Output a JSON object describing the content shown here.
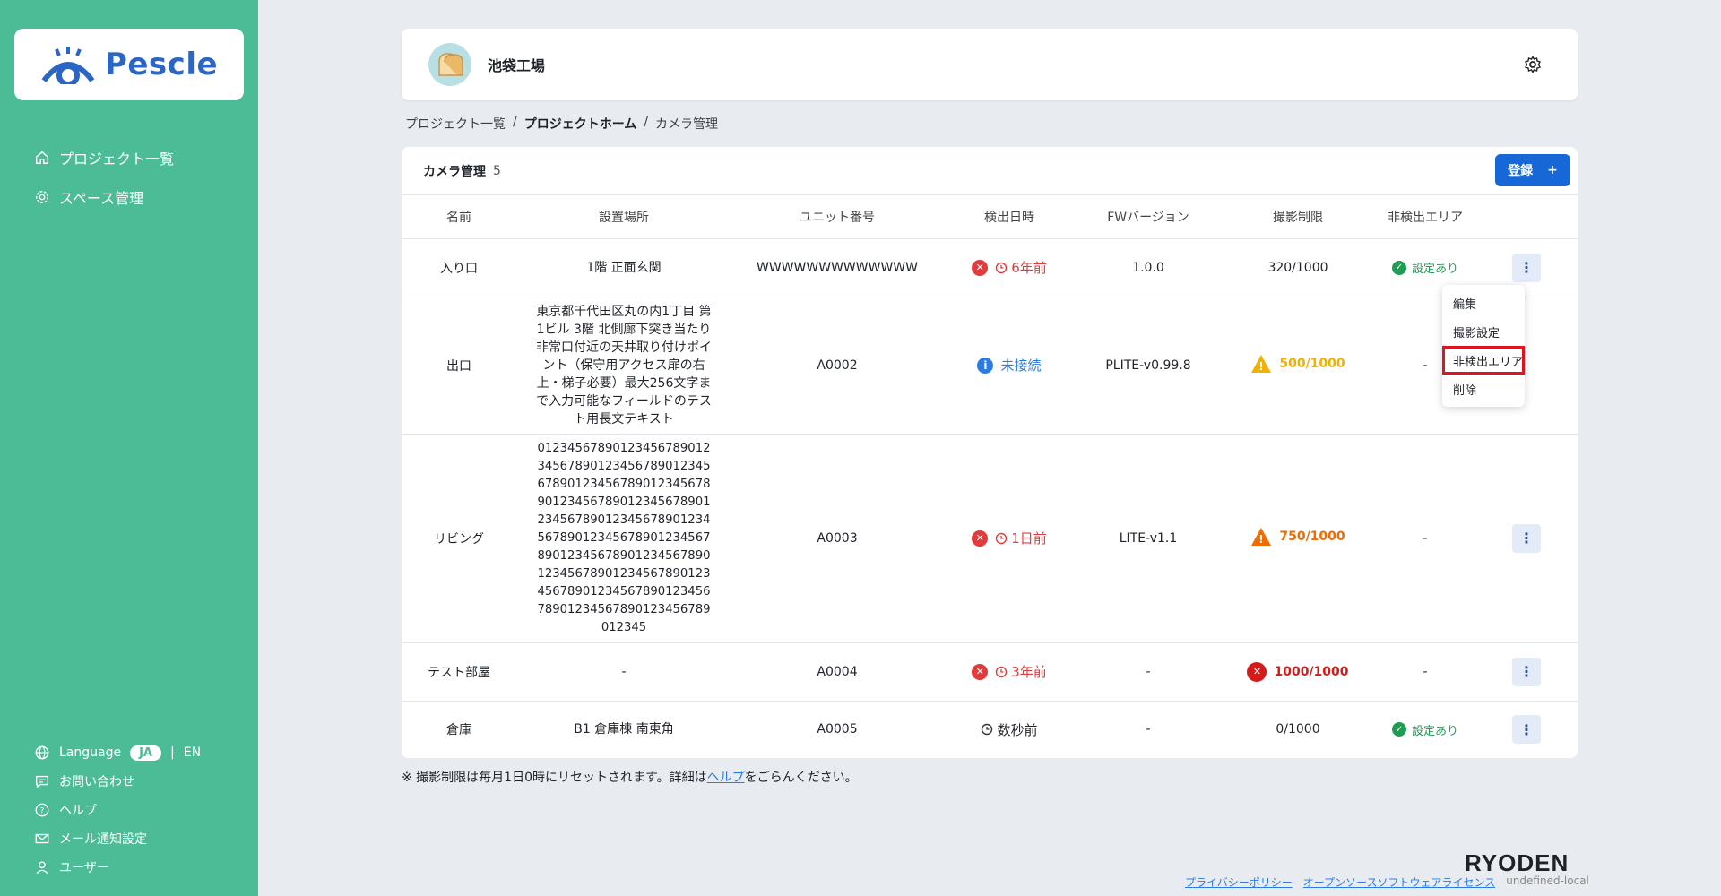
{
  "brand": {
    "logo": "Pescle",
    "footer_logo": "RYODEN"
  },
  "sidebar": {
    "nav": [
      {
        "label": "プロジェクト一覧",
        "icon": "home-icon"
      },
      {
        "label": "スペース管理",
        "icon": "gear-icon"
      }
    ],
    "language_label": "Language",
    "lang_ja": "JA",
    "lang_sep": "|",
    "lang_en": "EN",
    "bottom": [
      {
        "label": "お問い合わせ",
        "icon": "chat-icon"
      },
      {
        "label": "ヘルプ",
        "icon": "help-icon"
      },
      {
        "label": "メール通知設定",
        "icon": "mail-icon"
      },
      {
        "label": "ユーザー",
        "icon": "user-icon"
      }
    ]
  },
  "header": {
    "factory_name": "池袋工場"
  },
  "breadcrumb": {
    "items": [
      "プロジェクト一覧",
      "プロジェクトホーム",
      "カメラ管理"
    ],
    "separator": "/"
  },
  "table": {
    "title": "カメラ管理",
    "count": "5",
    "register_label": "登録",
    "columns": [
      "名前",
      "設置場所",
      "ユニット番号",
      "検出日時",
      "FWバージョン",
      "撮影制限",
      "非検出エリア"
    ],
    "rows": [
      {
        "name": "入り口",
        "location": "1階 正面玄関",
        "unit": "WWWWWWWWWWWWW",
        "status": "6年前",
        "fw": "1.0.0",
        "quota": "320/1000",
        "area": "設定あり"
      },
      {
        "name": "出口",
        "location": "東京都千代田区丸の内1丁目 第1ビル 3階 北側廊下突き当たり非常口付近の天井取り付けポイント（保守用アクセス扉の右上・梯子必要）最大256文字まで入力可能なフィールドのテスト用長文テキスト",
        "unit": "A0002",
        "status": "未接続",
        "fw": "PLITE-v0.99.8",
        "quota": "500/1000",
        "area": "-"
      },
      {
        "name": "リビング",
        "location": "01234567890123456789012345678901234567890123456789012345678901234567890123456789012345678901234567890123456789012345678901234567890123456789012345678901234567890123456789012345678901234567890123456789012345678901234567890123456789012345",
        "unit": "A0003",
        "status": "1日前",
        "fw": "LITE-v1.1",
        "quota": "750/1000",
        "area": "-"
      },
      {
        "name": "テスト部屋",
        "location": "-",
        "unit": "A0004",
        "status": "3年前",
        "fw": "-",
        "quota": "1000/1000",
        "area": "-"
      },
      {
        "name": "倉庫",
        "location": "B1 倉庫棟 南東角",
        "unit": "A0005",
        "status": "数秒前",
        "fw": "-",
        "quota": "0/1000",
        "area": "設定あり"
      }
    ]
  },
  "menu": {
    "items": [
      "編集",
      "撮影設定",
      "非検出エリア",
      "削除"
    ]
  },
  "note": {
    "prefix": "※ 撮影制限は毎月1日0時にリセットされます。詳細は",
    "link": "ヘルプ",
    "suffix": "をごらんください。"
  },
  "footer": {
    "privacy": "プライバシーポリシー",
    "oss": "オープンソースソフトウェアライセンス",
    "env": "undefined-local"
  },
  "colors": {
    "sidebar": "#4cbc96",
    "primary": "#1767d6",
    "error": "#e23b3b",
    "warning_yellow": "#f2b100",
    "warning_orange": "#f26b00",
    "ok": "#1f9d55",
    "highlight": "#e0141e"
  }
}
